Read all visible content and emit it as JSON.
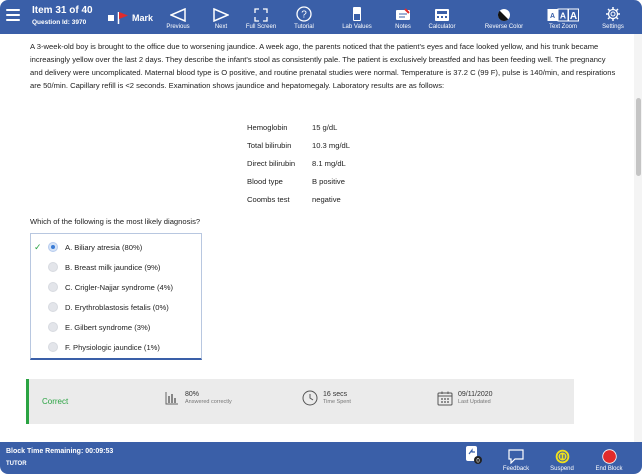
{
  "header": {
    "item_title": "Item 31 of 40",
    "question_id": "Question Id: 3970",
    "mark_label": "Mark",
    "tools": {
      "previous": "Previous",
      "next": "Next",
      "full_screen": "Full Screen",
      "tutorial": "Tutorial",
      "lab_values": "Lab Values",
      "notes": "Notes",
      "calculator": "Calculator",
      "reverse_color": "Reverse Color",
      "text_zoom": "Text Zoom",
      "settings": "Settings"
    }
  },
  "question": {
    "stem": "A 3-week-old boy is brought to the office due to worsening jaundice.  A week ago, the parents noticed that the patient's eyes and face looked yellow, and his trunk became increasingly yellow over the last 2 days.  They describe the infant's stool as consistently pale.  The patient is exclusively breastfed and has been feeding well.  The pregnancy and delivery were uncomplicated.  Maternal blood type is O positive, and routine prenatal studies were normal.  Temperature is 37.2 C (99 F), pulse is 140/min, and respirations are 50/min.  Capillary refill is <2 seconds.  Examination shows jaundice and hepatomegaly.  Laboratory results are as follows:",
    "labs": [
      {
        "name": "Hemoglobin",
        "value": "15 g/dL"
      },
      {
        "name": "Total bilirubin",
        "value": "10.3 mg/dL"
      },
      {
        "name": "Direct bilirubin",
        "value": "8.1 mg/dL"
      },
      {
        "name": "Blood type",
        "value": "B positive"
      },
      {
        "name": "Coombs test",
        "value": "negative"
      }
    ],
    "prompt": "Which of the following is the most likely diagnosis?",
    "answers": [
      {
        "label": "A.  Biliary atresia (80%)",
        "selected": true,
        "correct": true
      },
      {
        "label": "B.  Breast milk jaundice (9%)",
        "selected": false
      },
      {
        "label": "C.  Crigler-Najjar syndrome (4%)",
        "selected": false
      },
      {
        "label": "D.  Erythroblastosis fetalis (0%)",
        "selected": false
      },
      {
        "label": "E.  Gilbert syndrome (3%)",
        "selected": false
      },
      {
        "label": "F.  Physiologic jaundice (1%)",
        "selected": false
      }
    ]
  },
  "result": {
    "status": "Correct",
    "percent": "80%",
    "percent_label": "Answered correctly",
    "time": "16 secs",
    "time_label": "Time Spent",
    "date": "09/11/2020",
    "date_label": "Last Updated"
  },
  "footer": {
    "block_time": "Block Time Remaining: 00:09:53",
    "mode": "TUTOR",
    "feedback": "Feedback",
    "suspend": "Suspend",
    "end_block": "End Block",
    "badge_count": "0"
  },
  "colors": {
    "toolbar": "#3a5fa8",
    "correct": "#2aa342",
    "end_block": "#e12b2b",
    "suspend": "#f2e21a",
    "mark_flag": "#e12b2b"
  }
}
